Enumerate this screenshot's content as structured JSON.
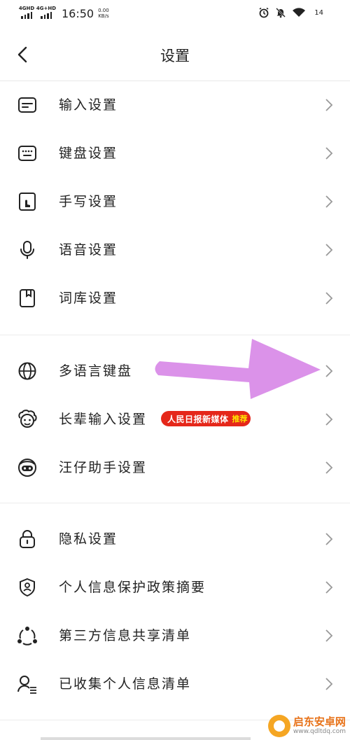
{
  "status_bar": {
    "sim1": "4GHD",
    "sim2": "4G+HD",
    "time": "16:50",
    "speed_value": "0.00",
    "speed_unit": "KB/s",
    "battery": "14",
    "icons": [
      "alarm-icon",
      "mute-bell-icon",
      "wifi-icon"
    ]
  },
  "nav": {
    "title": "设置",
    "back_icon": "chevron-left-icon"
  },
  "groups": [
    {
      "items": [
        {
          "label": "输入设置",
          "icon": "keyboard-input-icon"
        },
        {
          "label": "键盘设置",
          "icon": "keyboard-icon"
        },
        {
          "label": "手写设置",
          "icon": "handwriting-icon"
        },
        {
          "label": "语音设置",
          "icon": "microphone-icon"
        },
        {
          "label": "词库设置",
          "icon": "dictionary-icon"
        }
      ]
    },
    {
      "items": [
        {
          "label": "多语言键盘",
          "icon": "globe-icon"
        },
        {
          "label": "长辈输入设置",
          "icon": "elder-face-icon",
          "badge": "人民日报新媒体",
          "badge_tag": "推荐"
        },
        {
          "label": "汪仔助手设置",
          "icon": "assistant-dog-icon"
        }
      ]
    },
    {
      "items": [
        {
          "label": "隐私设置",
          "icon": "lock-icon"
        },
        {
          "label": "个人信息保护政策摘要",
          "icon": "shield-user-icon"
        },
        {
          "label": "第三方信息共享清单",
          "icon": "share-nodes-icon"
        },
        {
          "label": "已收集个人信息清单",
          "icon": "user-list-icon"
        }
      ]
    }
  ],
  "watermark": {
    "name": "启东安卓网",
    "url": "www.qdltdq.com"
  },
  "colors": {
    "badge_bg": "#e5271a",
    "badge_tag": "#ffe600",
    "annotation_arrow": "#d98ce8"
  }
}
